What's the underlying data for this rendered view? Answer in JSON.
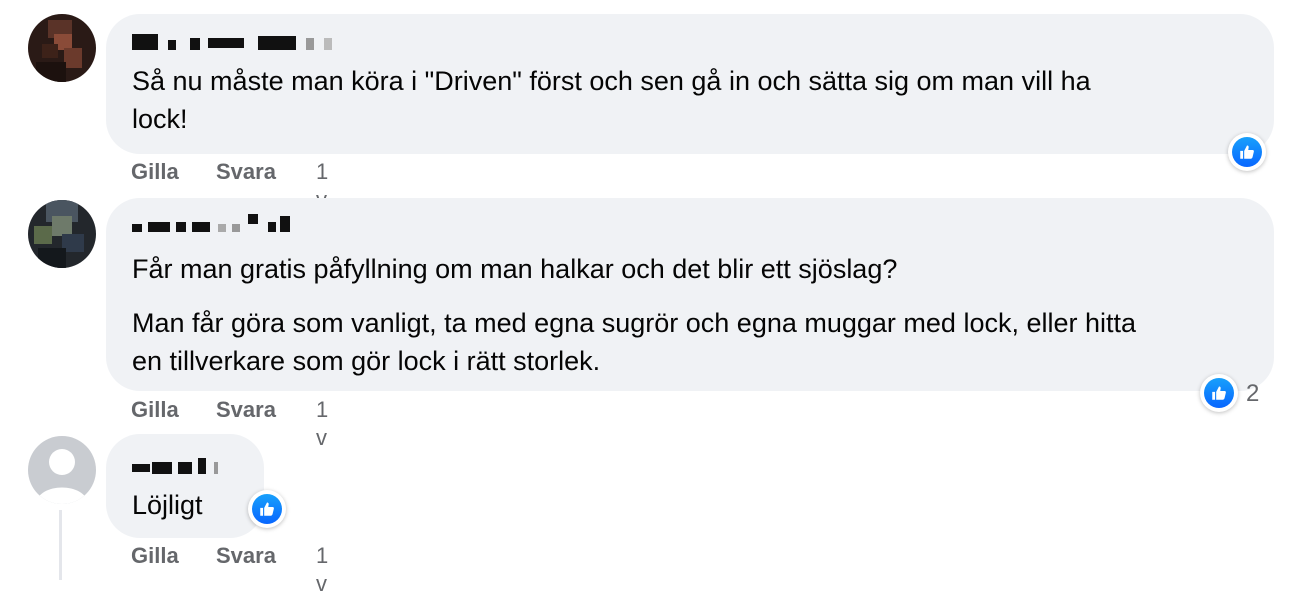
{
  "comments": [
    {
      "lines": [
        "Så nu måste man köra i \"Driven\" först och sen gå in och sätta sig om man vill ha",
        "lock!"
      ],
      "actions": {
        "like": "Gilla",
        "reply": "Svara",
        "time": "1 v"
      },
      "reaction_count": ""
    },
    {
      "paragraphs": [
        "Får man gratis påfyllning om man halkar och det blir ett sjöslag?",
        "Man får göra som vanligt, ta med egna sugrör och egna muggar med lock, eller hitta",
        "en tillverkare som gör lock i rätt storlek."
      ],
      "actions": {
        "like": "Gilla",
        "reply": "Svara",
        "time": "1 v"
      },
      "reaction_count": "2"
    },
    {
      "lines": [
        "Löjligt"
      ],
      "actions": {
        "like": "Gilla",
        "reply": "Svara",
        "time": "1 v"
      },
      "reaction_count": ""
    }
  ],
  "icons": {
    "reaction": "like-thumb-icon"
  },
  "colors": {
    "bubble": "#f0f2f5",
    "like_blue": "#0866ff",
    "meta_gray": "#65676b"
  }
}
